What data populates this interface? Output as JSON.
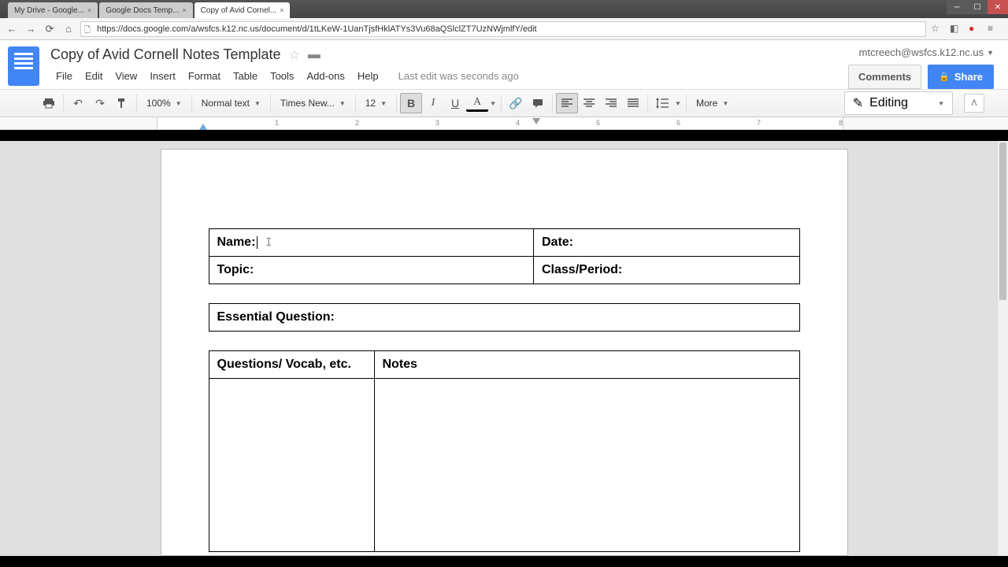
{
  "browser": {
    "tabs": [
      {
        "label": "My Drive - Google...",
        "active": false
      },
      {
        "label": "Google Docs Temp...",
        "active": false
      },
      {
        "label": "Copy of Avid Cornel...",
        "active": true
      }
    ],
    "url": "https://docs.google.com/a/wsfcs.k12.nc.us/document/d/1tLKeW-1UanTjsfHklATYs3Vu68aQSlclZT7UzNWjmlfY/edit"
  },
  "docs": {
    "title": "Copy of Avid Cornell Notes Template",
    "menus": [
      "File",
      "Edit",
      "View",
      "Insert",
      "Format",
      "Table",
      "Tools",
      "Add-ons",
      "Help"
    ],
    "lastEdit": "Last edit was seconds ago",
    "user": "mtcreech@wsfcs.k12.nc.us",
    "commentsBtn": "Comments",
    "shareBtn": "Share"
  },
  "toolbar": {
    "zoom": "100%",
    "style": "Normal text",
    "font": "Times New...",
    "size": "12",
    "more": "More",
    "editing": "Editing"
  },
  "ruler": {
    "ticks": [
      "1",
      "2",
      "3",
      "4",
      "5",
      "6",
      "7"
    ],
    "end": "8"
  },
  "template": {
    "nameLabel": "Name:",
    "dateLabel": "Date:",
    "topicLabel": "Topic:",
    "classLabel": "Class/Period:",
    "eqLabel": "Essential Question:",
    "questionsHeader": "Questions/ Vocab, etc.",
    "notesHeader": "Notes"
  }
}
